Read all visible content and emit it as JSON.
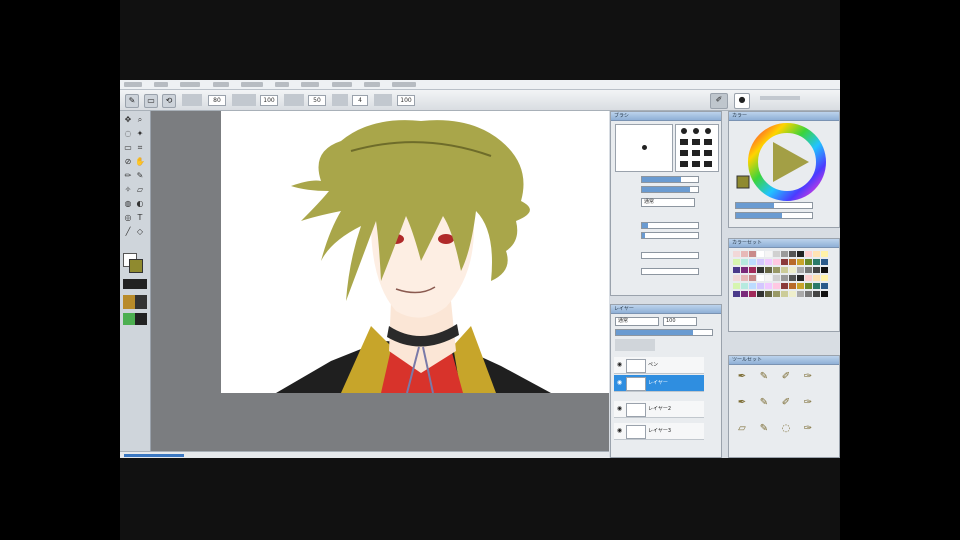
{
  "app": {
    "toolbar": {
      "size_value": "80",
      "density_value": "100",
      "hardness_value": "50",
      "stabilizer_value": "4",
      "spacing_value": "100"
    },
    "brush_panel": {
      "title": "ブラシ",
      "blend_mode_value": "通常",
      "brush_icon": "brush-tip-icon"
    },
    "color_panel": {
      "title": "カラー"
    },
    "swatch_panel": {
      "title": "カラーセット"
    },
    "layer_panel": {
      "title": "レイヤー",
      "blend_mode_value": "通常",
      "opacity_value": "100",
      "layers": [
        {
          "name": "ペン"
        },
        {
          "name": "レイヤー"
        },
        {
          "name": "レイヤー2"
        },
        {
          "name": "レイヤー3"
        }
      ]
    },
    "tool_panel": {
      "title": "ツールセット"
    },
    "colors": {
      "accent": "#2f8ee0",
      "hair": "#a9a64a",
      "collar": "#c7a52a",
      "inner": "#d8332b"
    }
  }
}
